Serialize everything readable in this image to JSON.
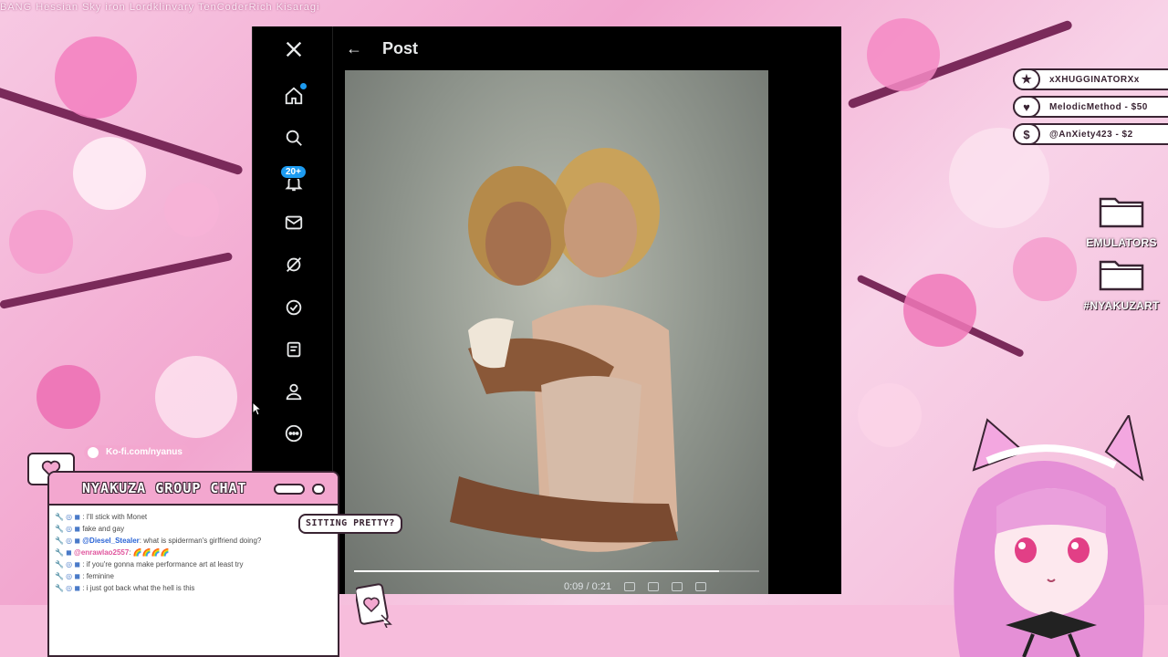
{
  "stream": {
    "credits_ticker": "BANG   Hessian   Sky iron   Lordklinvary   TenCoderRich   Kisaragi"
  },
  "x_app": {
    "header_title": "Post",
    "notification_badge": "20+",
    "nav_icons": [
      "x-logo-icon",
      "home-icon",
      "search-icon",
      "bell-icon",
      "mail-icon",
      "grok-icon",
      "verified-icon",
      "lists-icon",
      "profile-icon",
      "more-icon"
    ],
    "video_progress": 0.9,
    "video_time": "0:09 / 0:21"
  },
  "donations": [
    {
      "icon": "★",
      "text": "xXHUGGINATORXx"
    },
    {
      "icon": "♥",
      "text": "MelodicMethod - $50"
    },
    {
      "icon": "$",
      "text": "@AnXiety423 - $2"
    }
  ],
  "desktop": {
    "folders": [
      {
        "label": "EMULATORS"
      },
      {
        "label": "#NYAKUZART"
      }
    ]
  },
  "chat": {
    "kofi_link": "Ko-fi.com/nyanus",
    "title": "NYAKUZA GROUP CHAT",
    "messages": [
      {
        "user": "",
        "user_color": "green",
        "text": ": I'll stick with Monet"
      },
      {
        "user": "",
        "user_color": "green",
        "text": "fake and gay"
      },
      {
        "user": "@Diesel_Stealer",
        "user_color": "blue",
        "text": ": what is spiderman's girlfriend doing?"
      },
      {
        "user": "@enrawlao2557",
        "user_color": "blue",
        "text": ": 🌈🌈🌈🌈"
      },
      {
        "user": "",
        "user_color": "green",
        "text": ": if you're gonna make performance art at least try"
      },
      {
        "user": "",
        "user_color": "green",
        "text": ": feminine"
      },
      {
        "user": "",
        "user_color": "green",
        "text": ": i just got back what the hell is this"
      }
    ],
    "speech_bubble": "SITTING PRETTY?"
  },
  "colors": {
    "accent_pink": "#f3a7cf",
    "outline": "#3a2433",
    "x_blue": "#1d9bf0"
  }
}
